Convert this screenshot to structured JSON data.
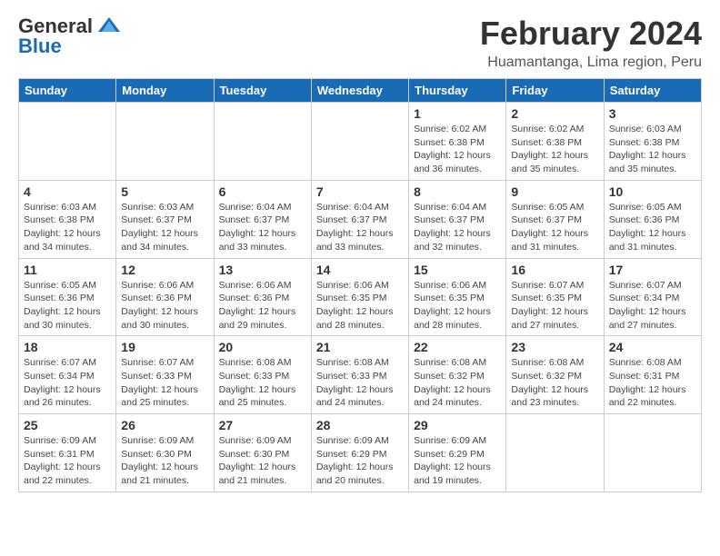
{
  "header": {
    "logo_general": "General",
    "logo_blue": "Blue",
    "month_title": "February 2024",
    "location": "Huamantanga, Lima region, Peru"
  },
  "weekdays": [
    "Sunday",
    "Monday",
    "Tuesday",
    "Wednesday",
    "Thursday",
    "Friday",
    "Saturday"
  ],
  "weeks": [
    [
      {
        "day": "",
        "detail": ""
      },
      {
        "day": "",
        "detail": ""
      },
      {
        "day": "",
        "detail": ""
      },
      {
        "day": "",
        "detail": ""
      },
      {
        "day": "1",
        "detail": "Sunrise: 6:02 AM\nSunset: 6:38 PM\nDaylight: 12 hours\nand 36 minutes."
      },
      {
        "day": "2",
        "detail": "Sunrise: 6:02 AM\nSunset: 6:38 PM\nDaylight: 12 hours\nand 35 minutes."
      },
      {
        "day": "3",
        "detail": "Sunrise: 6:03 AM\nSunset: 6:38 PM\nDaylight: 12 hours\nand 35 minutes."
      }
    ],
    [
      {
        "day": "4",
        "detail": "Sunrise: 6:03 AM\nSunset: 6:38 PM\nDaylight: 12 hours\nand 34 minutes."
      },
      {
        "day": "5",
        "detail": "Sunrise: 6:03 AM\nSunset: 6:37 PM\nDaylight: 12 hours\nand 34 minutes."
      },
      {
        "day": "6",
        "detail": "Sunrise: 6:04 AM\nSunset: 6:37 PM\nDaylight: 12 hours\nand 33 minutes."
      },
      {
        "day": "7",
        "detail": "Sunrise: 6:04 AM\nSunset: 6:37 PM\nDaylight: 12 hours\nand 33 minutes."
      },
      {
        "day": "8",
        "detail": "Sunrise: 6:04 AM\nSunset: 6:37 PM\nDaylight: 12 hours\nand 32 minutes."
      },
      {
        "day": "9",
        "detail": "Sunrise: 6:05 AM\nSunset: 6:37 PM\nDaylight: 12 hours\nand 31 minutes."
      },
      {
        "day": "10",
        "detail": "Sunrise: 6:05 AM\nSunset: 6:36 PM\nDaylight: 12 hours\nand 31 minutes."
      }
    ],
    [
      {
        "day": "11",
        "detail": "Sunrise: 6:05 AM\nSunset: 6:36 PM\nDaylight: 12 hours\nand 30 minutes."
      },
      {
        "day": "12",
        "detail": "Sunrise: 6:06 AM\nSunset: 6:36 PM\nDaylight: 12 hours\nand 30 minutes."
      },
      {
        "day": "13",
        "detail": "Sunrise: 6:06 AM\nSunset: 6:36 PM\nDaylight: 12 hours\nand 29 minutes."
      },
      {
        "day": "14",
        "detail": "Sunrise: 6:06 AM\nSunset: 6:35 PM\nDaylight: 12 hours\nand 28 minutes."
      },
      {
        "day": "15",
        "detail": "Sunrise: 6:06 AM\nSunset: 6:35 PM\nDaylight: 12 hours\nand 28 minutes."
      },
      {
        "day": "16",
        "detail": "Sunrise: 6:07 AM\nSunset: 6:35 PM\nDaylight: 12 hours\nand 27 minutes."
      },
      {
        "day": "17",
        "detail": "Sunrise: 6:07 AM\nSunset: 6:34 PM\nDaylight: 12 hours\nand 27 minutes."
      }
    ],
    [
      {
        "day": "18",
        "detail": "Sunrise: 6:07 AM\nSunset: 6:34 PM\nDaylight: 12 hours\nand 26 minutes."
      },
      {
        "day": "19",
        "detail": "Sunrise: 6:07 AM\nSunset: 6:33 PM\nDaylight: 12 hours\nand 25 minutes."
      },
      {
        "day": "20",
        "detail": "Sunrise: 6:08 AM\nSunset: 6:33 PM\nDaylight: 12 hours\nand 25 minutes."
      },
      {
        "day": "21",
        "detail": "Sunrise: 6:08 AM\nSunset: 6:33 PM\nDaylight: 12 hours\nand 24 minutes."
      },
      {
        "day": "22",
        "detail": "Sunrise: 6:08 AM\nSunset: 6:32 PM\nDaylight: 12 hours\nand 24 minutes."
      },
      {
        "day": "23",
        "detail": "Sunrise: 6:08 AM\nSunset: 6:32 PM\nDaylight: 12 hours\nand 23 minutes."
      },
      {
        "day": "24",
        "detail": "Sunrise: 6:08 AM\nSunset: 6:31 PM\nDaylight: 12 hours\nand 22 minutes."
      }
    ],
    [
      {
        "day": "25",
        "detail": "Sunrise: 6:09 AM\nSunset: 6:31 PM\nDaylight: 12 hours\nand 22 minutes."
      },
      {
        "day": "26",
        "detail": "Sunrise: 6:09 AM\nSunset: 6:30 PM\nDaylight: 12 hours\nand 21 minutes."
      },
      {
        "day": "27",
        "detail": "Sunrise: 6:09 AM\nSunset: 6:30 PM\nDaylight: 12 hours\nand 21 minutes."
      },
      {
        "day": "28",
        "detail": "Sunrise: 6:09 AM\nSunset: 6:29 PM\nDaylight: 12 hours\nand 20 minutes."
      },
      {
        "day": "29",
        "detail": "Sunrise: 6:09 AM\nSunset: 6:29 PM\nDaylight: 12 hours\nand 19 minutes."
      },
      {
        "day": "",
        "detail": ""
      },
      {
        "day": "",
        "detail": ""
      }
    ]
  ]
}
